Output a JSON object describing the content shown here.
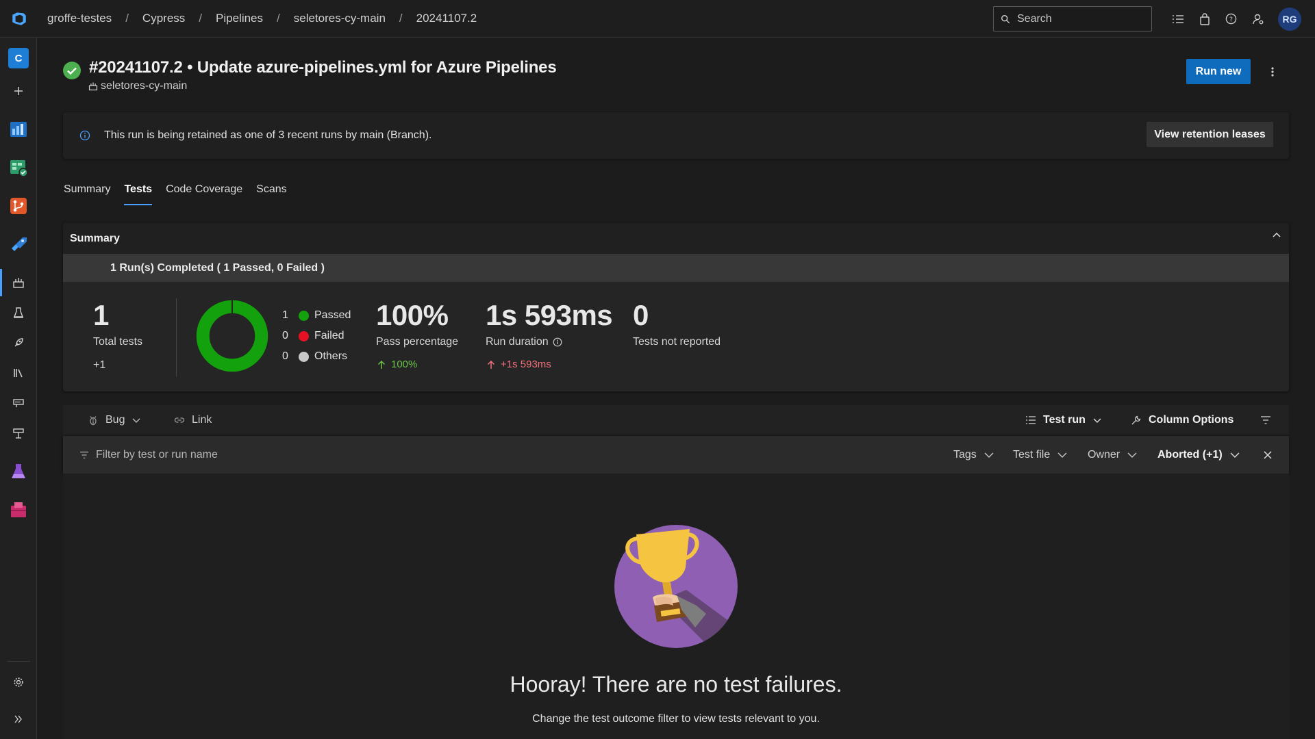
{
  "breadcrumb": [
    "groffe-testes",
    "Cypress",
    "Pipelines",
    "seletores-cy-main",
    "20241107.2"
  ],
  "search": {
    "placeholder": "Search"
  },
  "user": {
    "initials": "RG"
  },
  "project": {
    "badge": "C"
  },
  "run": {
    "title": "#20241107.2 • Update azure-pipelines.yml for Azure Pipelines",
    "pipeline": "seletores-cy-main",
    "status": "succeeded",
    "run_new_label": "Run new"
  },
  "banner": {
    "text": "This run is being retained as one of 3 recent runs by main (Branch).",
    "button": "View retention leases"
  },
  "tabs": [
    {
      "label": "Summary",
      "active": false
    },
    {
      "label": "Tests",
      "active": true
    },
    {
      "label": "Code Coverage",
      "active": false
    },
    {
      "label": "Scans",
      "active": false
    }
  ],
  "summary": {
    "header": "Summary",
    "runs_completed": "1 Run(s) Completed ( 1 Passed, 0 Failed )",
    "total_tests": {
      "value": "1",
      "label": "Total tests",
      "delta": "+1"
    },
    "outcomes": [
      {
        "count": "1",
        "label": "Passed",
        "color": "#13a10e"
      },
      {
        "count": "0",
        "label": "Failed",
        "color": "#e81123"
      },
      {
        "count": "0",
        "label": "Others",
        "color": "#c8c8c8"
      }
    ],
    "pass_percentage": {
      "value": "100%",
      "label": "Pass percentage",
      "delta": "100%"
    },
    "run_duration": {
      "value": "1s 593ms",
      "label": "Run duration",
      "delta": "+1s 593ms"
    },
    "not_reported": {
      "value": "0",
      "label": "Tests not reported"
    }
  },
  "toolbar": {
    "bug": "Bug",
    "link": "Link",
    "test_run": "Test run",
    "column_options": "Column Options"
  },
  "filter": {
    "placeholder": "Filter by test or run name",
    "tags": "Tags",
    "test_file": "Test file",
    "owner": "Owner",
    "outcome": "Aborted (+1)"
  },
  "empty_state": {
    "title": "Hooray! There are no test failures.",
    "subtitle": "Change the test outcome filter to view tests relevant to you."
  },
  "colors": {
    "accent": "#0f6cbd",
    "success": "#13a10e",
    "delta_up_good": "#6cc24a",
    "delta_up_bad": "#f1707b"
  }
}
